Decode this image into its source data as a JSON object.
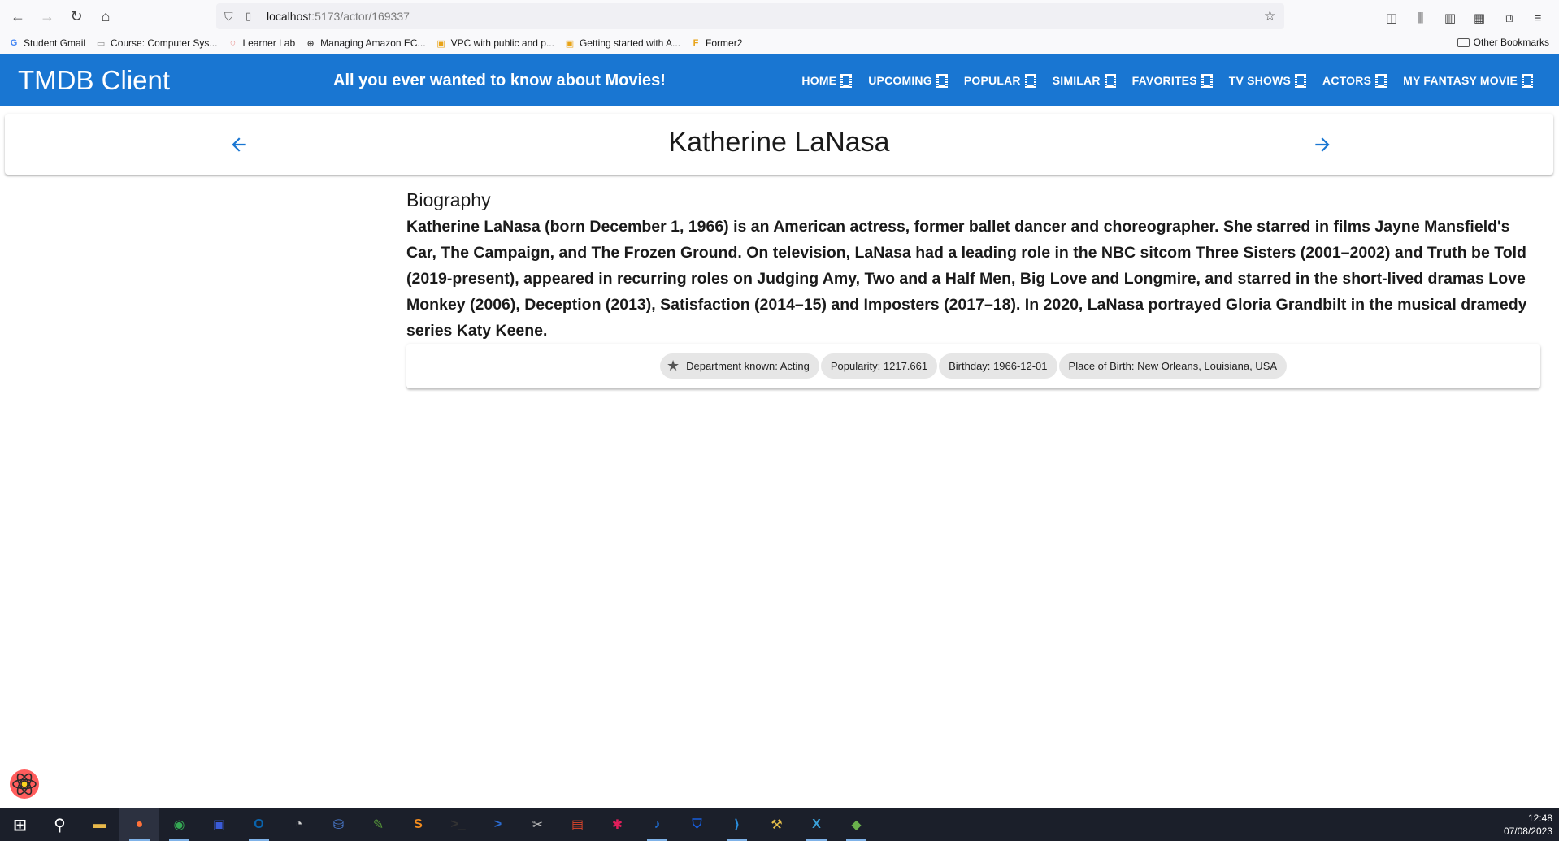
{
  "browser": {
    "url_host": "localhost",
    "url_path": ":5173/actor/169337",
    "bookmarks": [
      {
        "label": "Student Gmail",
        "icon": "google-icon",
        "color": "#4285f4"
      },
      {
        "label": "Course: Computer Sys...",
        "icon": "course-icon",
        "color": "#8a8a8a"
      },
      {
        "label": "Learner Lab",
        "icon": "learner-lab-icon",
        "color": "#d93025"
      },
      {
        "label": "Managing Amazon EC...",
        "icon": "globe-icon",
        "color": "#444444"
      },
      {
        "label": "VPC with public and p...",
        "icon": "aws-box-icon",
        "color": "#e8a317"
      },
      {
        "label": "Getting started with A...",
        "icon": "aws-box-icon",
        "color": "#e8a317"
      },
      {
        "label": "Former2",
        "icon": "former2-icon",
        "color": "#e8a317"
      }
    ],
    "other_bookmarks": "Other Bookmarks"
  },
  "app": {
    "title": "TMDB Client",
    "tagline": "All you ever wanted to know about Movies!",
    "nav": [
      {
        "label": "Home"
      },
      {
        "label": "Upcoming"
      },
      {
        "label": "Popular"
      },
      {
        "label": "Similar"
      },
      {
        "label": "Favorites"
      },
      {
        "label": "TV Shows"
      },
      {
        "label": "Actors"
      },
      {
        "label": "My Fantasy Movie"
      }
    ],
    "brand_color": "#1976d2"
  },
  "actor": {
    "name": "Katherine LaNasa",
    "bio_heading": "Biography",
    "biography": "Katherine LaNasa (born December 1, 1966) is an American actress, former ballet dancer and choreographer. She starred in films Jayne Mansfield's Car, The Campaign, and The Frozen Ground. On television, LaNasa had a leading role in the NBC sitcom Three Sisters (2001–2002) and Truth be Told (2019-present), appeared in recurring roles on Judging Amy, Two and a Half Men, Big Love and Longmire, and starred in the short-lived dramas Love Monkey (2006), Deception (2013), Satisfaction (2014–15) and Imposters (2017–18). In 2020, LaNasa portrayed Gloria Grandbilt in the musical dramedy series Katy Keene.",
    "chips": {
      "department": "Department known: Acting",
      "popularity": "Popularity: 1217.661",
      "birthday": "Birthday: 1966-12-01",
      "birthplace": "Place of Birth: New Orleans, Louisiana, USA"
    }
  },
  "taskbar": {
    "time": "12:48",
    "date": "07/08/2023",
    "apps": [
      {
        "name": "start-icon",
        "color": "#ffffff",
        "glyph": "⊞"
      },
      {
        "name": "search-icon",
        "color": "#ffffff",
        "glyph": "⚲"
      },
      {
        "name": "file-explorer-icon",
        "color": "#e8b84a",
        "glyph": "▬"
      },
      {
        "name": "firefox-icon",
        "color": "#ff7139",
        "glyph": "●"
      },
      {
        "name": "chrome-icon",
        "color": "#34a853",
        "glyph": "◉"
      },
      {
        "name": "save-app-icon",
        "color": "#3a5bd9",
        "glyph": "▣"
      },
      {
        "name": "outlook-icon",
        "color": "#0a64ad",
        "glyph": "O"
      },
      {
        "name": "clock-app-icon",
        "color": "#d0d0d0",
        "glyph": "◔"
      },
      {
        "name": "network-app-icon",
        "color": "#4a7bd0",
        "glyph": "⛁"
      },
      {
        "name": "notepad-app-icon",
        "color": "#5a9e3a",
        "glyph": "✎"
      },
      {
        "name": "sublime-text-icon",
        "color": "#f28b1e",
        "glyph": "S"
      },
      {
        "name": "terminal-icon",
        "color": "#333333",
        "glyph": ">_"
      },
      {
        "name": "powershell-icon",
        "color": "#2a6acf",
        "glyph": ">"
      },
      {
        "name": "clapper-app-icon",
        "color": "#bbbbbb",
        "glyph": "✂"
      },
      {
        "name": "pdf-app-icon",
        "color": "#e0452a",
        "glyph": "▤"
      },
      {
        "name": "slack-icon",
        "color": "#e01e5a",
        "glyph": "✱"
      },
      {
        "name": "tiktok-app-icon",
        "color": "#1f6fd8",
        "glyph": "♪"
      },
      {
        "name": "bitwarden-icon",
        "color": "#175ddc",
        "glyph": "⛉"
      },
      {
        "name": "vscode-icon",
        "color": "#2b8fe0",
        "glyph": "⟩"
      },
      {
        "name": "tools-app-icon",
        "color": "#e8c04a",
        "glyph": "⚒"
      },
      {
        "name": "x-app-icon",
        "color": "#3aa0d8",
        "glyph": "X"
      },
      {
        "name": "git-app-icon",
        "color": "#6ab04c",
        "glyph": "◆"
      }
    ]
  }
}
